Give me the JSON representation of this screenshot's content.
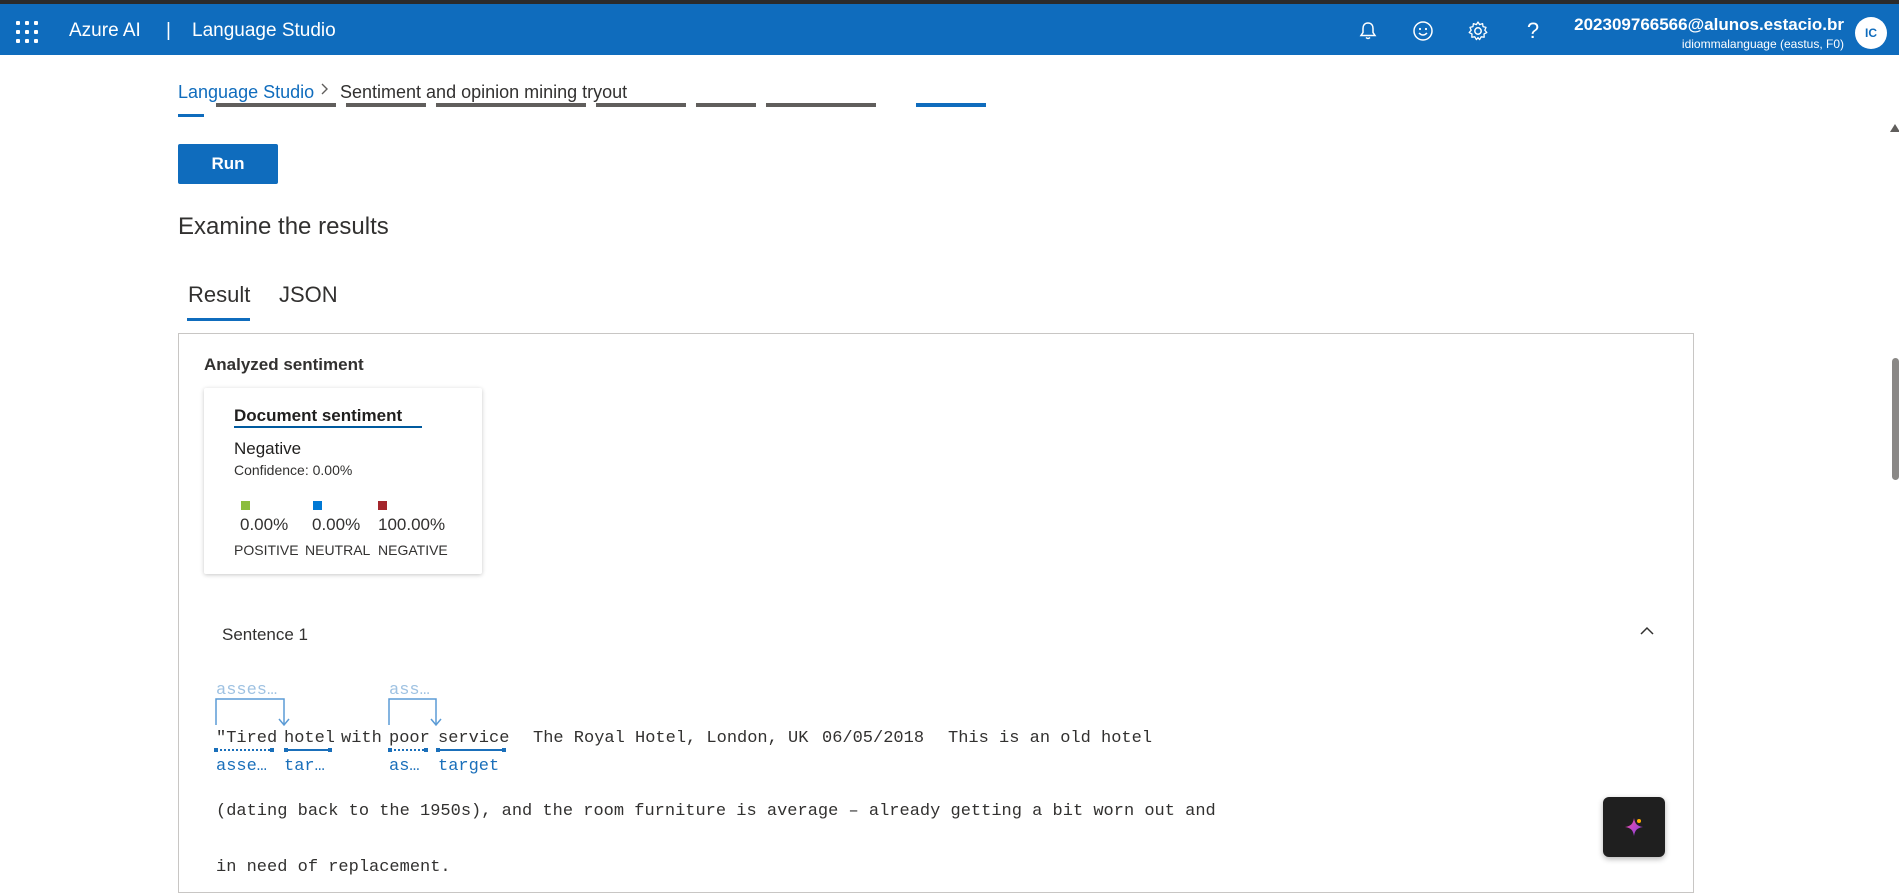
{
  "colors": {
    "brand": "#0f6cbd",
    "link": "#0f6cbd",
    "positive": "#8cbd3f",
    "neutral": "#0078d4",
    "negative": "#a4262c"
  },
  "topbar": {
    "product": "Azure AI",
    "separator": "|",
    "app": "Language Studio",
    "user_email": "202309766566@alunos.estacio.br",
    "user_resource": "idiommalanguage (eastus, F0)",
    "avatar_initials": "IC",
    "icons": [
      "waffle-icon",
      "bell-icon",
      "smiley-icon",
      "gear-icon",
      "help-icon"
    ]
  },
  "breadcrumb": {
    "link": "Language Studio",
    "separator": ">",
    "current": "Sentiment and opinion mining tryout"
  },
  "run_button": "Run",
  "results": {
    "title": "Examine the results",
    "tabs": [
      "Result",
      "JSON"
    ],
    "active_tab": "Result"
  },
  "analyzed": {
    "heading": "Analyzed sentiment"
  },
  "document_sentiment": {
    "title": "Document sentiment",
    "label": "Negative",
    "confidence": "Confidence: 0.00%",
    "scores": [
      {
        "value": "0.00%",
        "category": "POSITIVE"
      },
      {
        "value": "0.00%",
        "category": "NEUTRAL"
      },
      {
        "value": "100.00%",
        "category": "NEGATIVE"
      }
    ]
  },
  "sentence": {
    "title": "Sentence 1",
    "top_labels": [
      "asses…",
      "ass…"
    ],
    "words": [
      "\"Tired",
      "hotel",
      "with",
      "poor",
      "service",
      "The Royal Hotel, London, UK",
      "06/05/2018",
      "This is an old hotel"
    ],
    "bottom_labels": [
      "asse…",
      "tar…",
      "as…",
      "target"
    ],
    "line2": "(dating back to the 1950s), and the room furniture is average – already getting a bit worn out and",
    "line3": "in need of replacement."
  }
}
